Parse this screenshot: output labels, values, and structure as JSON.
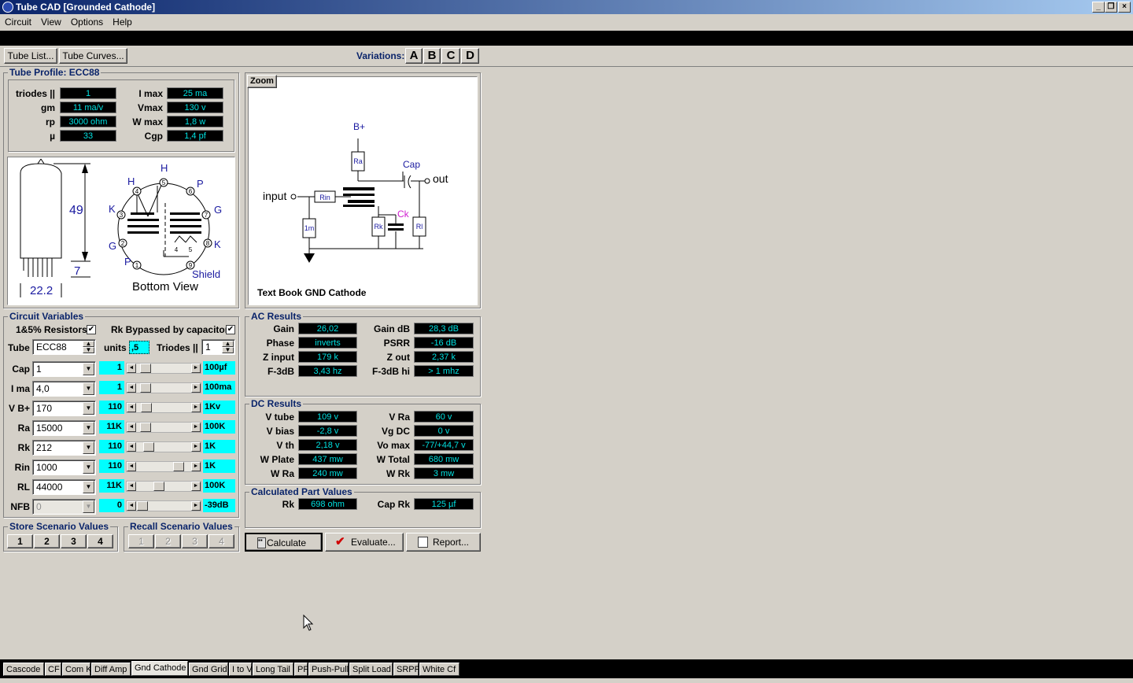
{
  "window": {
    "title": "Tube CAD  [Grounded Cathode]"
  },
  "menu": [
    "Circuit",
    "View",
    "Options",
    "Help"
  ],
  "toolbar": {
    "tube_list": "Tube List...",
    "tube_curves": "Tube Curves...",
    "variations_label": "Variations:",
    "variations": [
      "A",
      "B",
      "C",
      "D"
    ]
  },
  "tube_profile": {
    "title": "Tube Profile: ECC88",
    "left": [
      {
        "label": "triodes ||",
        "value": "1"
      },
      {
        "label": "gm",
        "value": "11 ma/v"
      },
      {
        "label": "rp",
        "value": "3000 ohm"
      },
      {
        "label": "µ",
        "value": "33"
      }
    ],
    "right": [
      {
        "label": "I max",
        "value": "25 ma"
      },
      {
        "label": "Vmax",
        "value": "130 v"
      },
      {
        "label": "W max",
        "value": "1,8 w"
      },
      {
        "label": "Cgp",
        "value": "1,4 pf"
      }
    ]
  },
  "tube_diagram": {
    "height": "49",
    "pin_length": "7",
    "diameter": "22.2",
    "view": "Bottom View",
    "shield": "Shield",
    "pins": [
      "1",
      "2",
      "3",
      "4",
      "5",
      "6",
      "7",
      "8",
      "9"
    ],
    "pin_labels": {
      "h1": "H",
      "h2": "H",
      "p1": "P",
      "p2": "P",
      "k1": "K",
      "k2": "K",
      "g1": "G",
      "g2": "G"
    },
    "heater_taps": [
      "4",
      "5"
    ]
  },
  "schematic": {
    "zoom": "Zoom",
    "caption": "Text Book GND Cathode",
    "bplus": "B+",
    "input": "input",
    "output": "out",
    "cap": "Cap",
    "ck": "Ck",
    "ra": "Ra",
    "rin": "Rin",
    "rk": "Rk",
    "rl": "Rl",
    "rg": "1m"
  },
  "circuit_vars": {
    "title": "Circuit Variables",
    "resistors": "1&5% Resistors",
    "rk_bypass": "Rk Bypassed by capacitor",
    "tube_label": "Tube",
    "tube_value": "ECC88",
    "units_label": "units",
    "units_value": ",5",
    "triodes_label": "Triodes ||",
    "triodes_value": "1",
    "rows": [
      {
        "label": "Cap",
        "value": "1",
        "min": "1",
        "max": "100µf",
        "pos": 0.08
      },
      {
        "label": "I ma",
        "value": "4,0",
        "min": "1",
        "max": "100ma",
        "pos": 0.08
      },
      {
        "label": "V B+",
        "value": "170",
        "min": "110",
        "max": "1Kv",
        "pos": 0.1
      },
      {
        "label": "Ra",
        "value": "15000",
        "min": "11K",
        "max": "100K",
        "pos": 0.08
      },
      {
        "label": "Rk",
        "value": "212",
        "min": "110",
        "max": "1K",
        "pos": 0.14
      },
      {
        "label": "Rin",
        "value": "1000",
        "min": "110",
        "max": "1K",
        "pos": 0.85
      },
      {
        "label": "RL",
        "value": "44000",
        "min": "11K",
        "max": "100K",
        "pos": 0.38
      },
      {
        "label": "NFB",
        "value": "0",
        "min": "0",
        "max": "-39dB",
        "pos": 0.0
      }
    ]
  },
  "store": {
    "title": "Store Scenario Values",
    "buttons": [
      "1",
      "2",
      "3",
      "4"
    ]
  },
  "recall": {
    "title": "Recall Scenario Values",
    "buttons": [
      "1",
      "2",
      "3",
      "4"
    ]
  },
  "ac": {
    "title": "AC Results",
    "left": [
      {
        "label": "Gain",
        "value": "26,02"
      },
      {
        "label": "Phase",
        "value": "inverts"
      },
      {
        "label": "Z input",
        "value": "179 k"
      },
      {
        "label": "F-3dB",
        "value": "3,43 hz"
      }
    ],
    "right": [
      {
        "label": "Gain dB",
        "value": "28,3 dB"
      },
      {
        "label": "PSRR",
        "value": "-16 dB"
      },
      {
        "label": "Z out",
        "value": "2,37 k"
      },
      {
        "label": "F-3dB hi",
        "value": "> 1 mhz"
      }
    ]
  },
  "dc": {
    "title": "DC Results",
    "left": [
      {
        "label": "V tube",
        "value": "109 v"
      },
      {
        "label": "V bias",
        "value": "-2,8 v"
      },
      {
        "label": "V th",
        "value": "2,18 v"
      },
      {
        "label": "W Plate",
        "value": "437 mw"
      },
      {
        "label": "W Ra",
        "value": "240 mw"
      }
    ],
    "right": [
      {
        "label": "V Ra",
        "value": "60 v"
      },
      {
        "label": "Vg DC",
        "value": "0 v"
      },
      {
        "label": "Vo max",
        "value": "-77/+44,7 v"
      },
      {
        "label": "W Total",
        "value": "680 mw"
      },
      {
        "label": "W Rk",
        "value": "3 mw"
      }
    ]
  },
  "calc": {
    "title": "Calculated Part Values",
    "rk_label": "Rk",
    "rk_value": "698 ohm",
    "cap_label": "Cap Rk",
    "cap_value": "125 µf"
  },
  "actions": {
    "calculate": "Calculate",
    "evaluate": "Evaluate...",
    "report": "Report..."
  },
  "tabs": [
    "Cascode",
    "CF",
    "Com K",
    "Diff Amp",
    "Gnd Cathode",
    "Gnd Grid",
    "I to V",
    "Long Tail",
    "PF",
    "Push-Pull",
    "Split Load",
    "SRPP",
    "White Cf"
  ],
  "active_tab": "Gnd Cathode",
  "colors": {
    "title_start": "#0a246a",
    "title_end": "#a6caf0",
    "value_bg": "#000000",
    "value_fg": "#00e0e0",
    "slider": "#00ffff",
    "group_title": "#0a246a"
  }
}
